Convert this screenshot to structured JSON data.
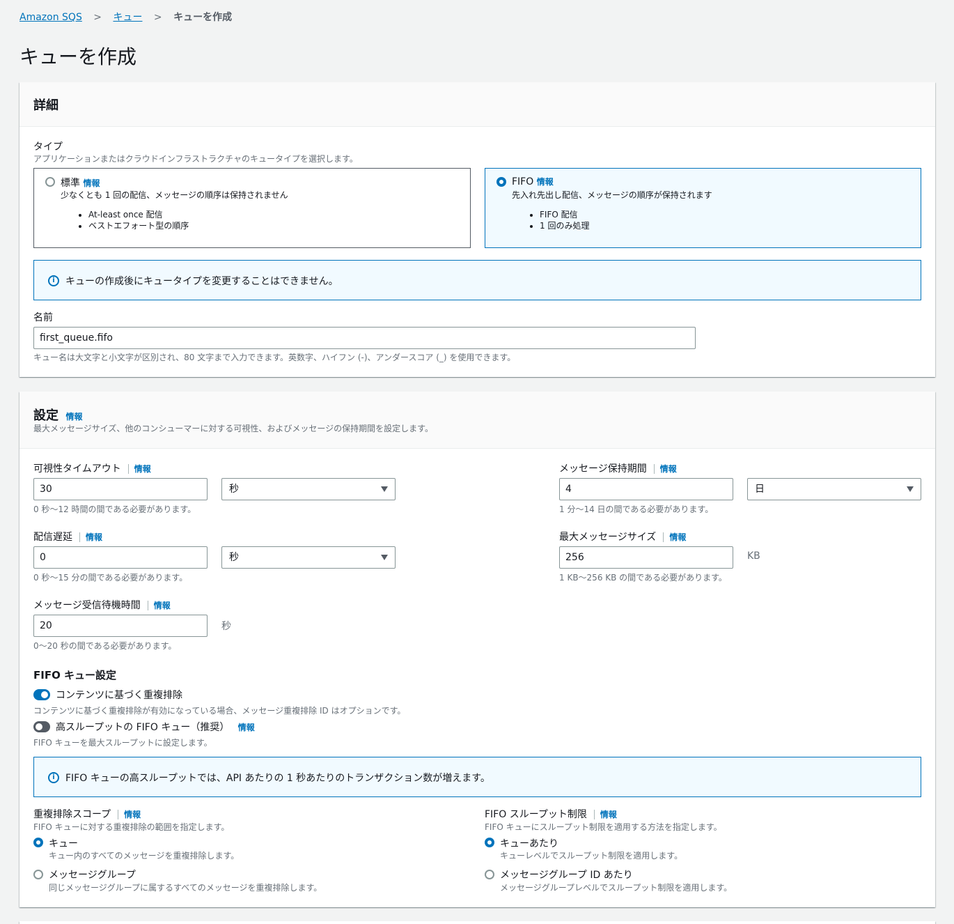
{
  "breadcrumb": {
    "root": "Amazon SQS",
    "parent": "キュー",
    "current": "キューを作成"
  },
  "page_title": "キューを作成",
  "info_label": "情報",
  "details": {
    "title": "詳細",
    "type_label": "タイプ",
    "type_description": "アプリケーションまたはクラウドインフラストラクチャのキュータイプを選択します。",
    "standard": {
      "title": "標準",
      "description": "少なくとも 1 回の配信、メッセージの順序は保持されません",
      "bullets": [
        "At-least once 配信",
        "ベストエフォート型の順序"
      ],
      "selected": false
    },
    "fifo": {
      "title": "FIFO",
      "description": "先入れ先出し配信、メッセージの順序が保持されます",
      "bullets": [
        "FIFO 配信",
        "1 回のみ処理"
      ],
      "selected": true
    },
    "type_alert": "キューの作成後にキュータイプを変更することはできません。",
    "name_label": "名前",
    "name_value": "first_queue.fifo",
    "name_hint": "キュー名は大文字と小文字が区別され、80 文字まで入力できます。英数字、ハイフン (-)、アンダースコア (_) を使用できます。"
  },
  "settings": {
    "title": "設定",
    "description": "最大メッセージサイズ、他のコンシューマーに対する可視性、およびメッセージの保持期間を設定します。",
    "visibility_timeout": {
      "label": "可視性タイムアウト",
      "value": "30",
      "unit": "秒",
      "hint": "0 秒〜12 時間の間である必要があります。"
    },
    "retention_period": {
      "label": "メッセージ保持期間",
      "value": "4",
      "unit": "日",
      "hint": "1 分〜14 日の間である必要があります。"
    },
    "delivery_delay": {
      "label": "配信遅延",
      "value": "0",
      "unit": "秒",
      "hint": "0 秒〜15 分の間である必要があります。"
    },
    "max_message_size": {
      "label": "最大メッセージサイズ",
      "value": "256",
      "unit": "KB",
      "hint": "1 KB〜256 KB の間である必要があります。"
    },
    "receive_wait_time": {
      "label": "メッセージ受信待機時間",
      "value": "20",
      "unit": "秒",
      "hint": "0〜20 秒の間である必要があります。"
    },
    "fifo_title": "FIFO キュー設定",
    "content_dedup": {
      "label": "コンテンツに基づく重複排除",
      "hint": "コンテンツに基づく重複排除が有効になっている場合、メッセージ重複排除 ID はオプションです。",
      "enabled": true
    },
    "high_throughput": {
      "label": "高スループットの FIFO キュー（推奨）",
      "hint": "FIFO キューを最大スループットに設定します。",
      "enabled": false
    },
    "throughput_alert": "FIFO キューの高スループットでは、API あたりの 1 秒あたりのトランザクション数が増えます。",
    "dedup_scope": {
      "label": "重複排除スコープ",
      "hint": "FIFO キューに対する重複排除の範囲を指定します。",
      "options": [
        {
          "label": "キュー",
          "hint": "キュー内のすべてのメッセージを重複排除します。",
          "selected": true
        },
        {
          "label": "メッセージグループ",
          "hint": "同じメッセージグループに属するすべてのメッセージを重複排除します。",
          "selected": false
        }
      ]
    },
    "throughput_limit": {
      "label": "FIFO スループット制限",
      "hint": "FIFO キューにスループット制限を適用する方法を指定します。",
      "options": [
        {
          "label": "キューあたり",
          "hint": "キューレベルでスループット制限を適用します。",
          "selected": true
        },
        {
          "label": "メッセージグループ ID あたり",
          "hint": "メッセージグループレベルでスループット制限を適用します。",
          "selected": false
        }
      ]
    }
  },
  "colors": {
    "accent": "#0073bb",
    "toggle_on": "#0073bb",
    "toggle_off": "#545b64"
  }
}
